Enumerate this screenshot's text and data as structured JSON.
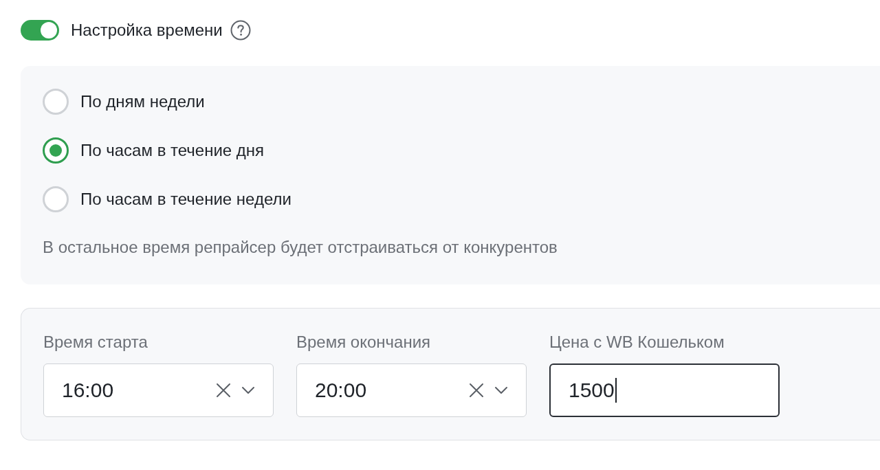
{
  "time_settings": {
    "enabled": true,
    "title": "Настройка времени"
  },
  "schedule_modes": [
    {
      "label": "По дням недели",
      "selected": false
    },
    {
      "label": "По часам в течение дня",
      "selected": true
    },
    {
      "label": "По часам в течение недели",
      "selected": false
    }
  ],
  "note": "В остальное время репрайсер будет отстраиваться от конкурентов",
  "fields": [
    {
      "kind": "select",
      "label": "Время старта",
      "value": "16:00",
      "focused": false
    },
    {
      "kind": "select",
      "label": "Время окончания",
      "value": "20:00",
      "focused": false
    },
    {
      "kind": "input",
      "label": "Цена с WB Кошельком",
      "value": "1500",
      "focused": true
    }
  ]
}
